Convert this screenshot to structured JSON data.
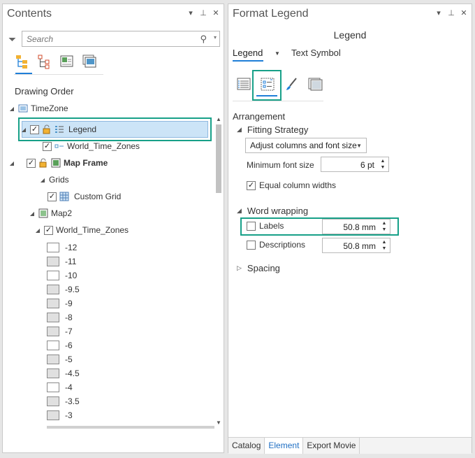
{
  "contents": {
    "title": "Contents",
    "search_placeholder": "Search",
    "drawing_order_label": "Drawing Order",
    "tree": {
      "timezone": "TimeZone",
      "legend": "Legend",
      "world_time_zones_1": "World_Time_Zones",
      "map_frame": "Map Frame",
      "grids": "Grids",
      "custom_grid": "Custom Grid",
      "map2": "Map2",
      "world_time_zones_2": "World_Time_Zones"
    },
    "zone_values": [
      {
        "label": "-12",
        "fill": "#ffffff"
      },
      {
        "label": "-11",
        "fill": "#e0e0e0"
      },
      {
        "label": "-10",
        "fill": "#ffffff"
      },
      {
        "label": "-9.5",
        "fill": "#e0e0e0"
      },
      {
        "label": "-9",
        "fill": "#e0e0e0"
      },
      {
        "label": "-8",
        "fill": "#e0e0e0"
      },
      {
        "label": "-7",
        "fill": "#e0e0e0"
      },
      {
        "label": "-6",
        "fill": "#ffffff"
      },
      {
        "label": "-5",
        "fill": "#e0e0e0"
      },
      {
        "label": "-4.5",
        "fill": "#e0e0e0"
      },
      {
        "label": "-4",
        "fill": "#ffffff"
      },
      {
        "label": "-3.5",
        "fill": "#e0e0e0"
      },
      {
        "label": "-3",
        "fill": "#e0e0e0"
      }
    ]
  },
  "format_legend": {
    "title": "Format Legend",
    "subtitle": "Legend",
    "tab_legend": "Legend",
    "tab_text_symbol": "Text Symbol",
    "arrangement_label": "Arrangement",
    "fitting_strategy_label": "Fitting Strategy",
    "fitting_strategy_value": "Adjust columns and font size",
    "min_font_size_label": "Minimum font size",
    "min_font_size_value": "6 pt",
    "equal_column_widths_label": "Equal column widths",
    "word_wrapping_label": "Word wrapping",
    "labels_label": "Labels",
    "labels_value": "50.8 mm",
    "descriptions_label": "Descriptions",
    "descriptions_value": "50.8 mm",
    "spacing_label": "Spacing"
  },
  "bottom_tabs": [
    "Catalog",
    "Element",
    "Export Movie"
  ],
  "colors": {
    "highlight_border": "#17a088",
    "accent_blue": "#1f7fd8",
    "selection_fill": "#cce4f7"
  }
}
